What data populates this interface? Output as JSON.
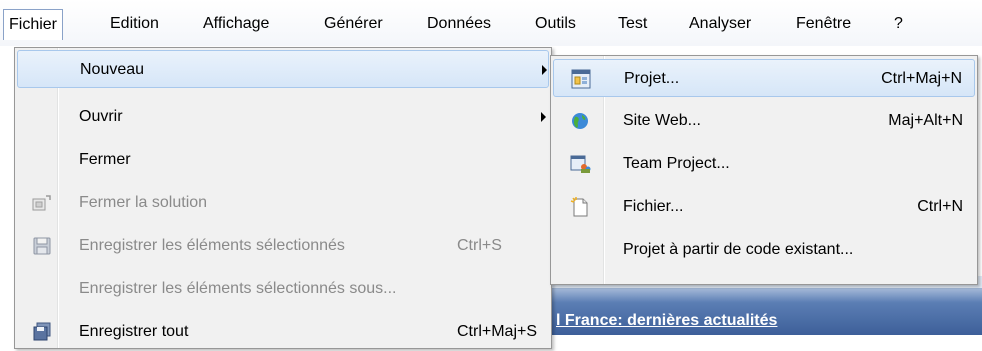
{
  "menubar": {
    "items": [
      {
        "label": "Fichier",
        "open": true
      },
      {
        "label": "Edition"
      },
      {
        "label": "Affichage"
      },
      {
        "label": "Générer"
      },
      {
        "label": "Données"
      },
      {
        "label": "Outils"
      },
      {
        "label": "Test"
      },
      {
        "label": "Analyser"
      },
      {
        "label": "Fenêtre"
      },
      {
        "label": "?"
      }
    ]
  },
  "file_menu": {
    "items": [
      {
        "label": "Nouveau",
        "submenu": true,
        "highlighted": true
      },
      {
        "label": "Ouvrir",
        "submenu": true
      },
      {
        "label": "Fermer"
      },
      {
        "label": "Fermer la solution",
        "disabled": true,
        "icon": "close-solution-icon"
      },
      {
        "label": "Enregistrer les éléments sélectionnés",
        "shortcut": "Ctrl+S",
        "disabled": true,
        "icon": "save-icon"
      },
      {
        "label": "Enregistrer les éléments sélectionnés sous...",
        "disabled": true
      },
      {
        "label": "Enregistrer tout",
        "shortcut": "Ctrl+Maj+S",
        "icon": "save-all-icon"
      }
    ]
  },
  "new_submenu": {
    "items": [
      {
        "label": "Projet...",
        "shortcut": "Ctrl+Maj+N",
        "highlighted": true,
        "icon": "project-icon"
      },
      {
        "label": "Site Web...",
        "shortcut": "Maj+Alt+N",
        "icon": "website-globe-icon"
      },
      {
        "label": "Team Project...",
        "icon": "team-project-icon"
      },
      {
        "label": "Fichier...",
        "shortcut": "Ctrl+N",
        "icon": "new-file-icon"
      },
      {
        "label": "Projet à partir de code existant..."
      }
    ]
  },
  "background": {
    "caption": "l France: dernières actualités"
  },
  "colors": {
    "highlight_border": "#a8c8ec",
    "highlight_fill": "#d6e6f8",
    "disabled_text": "#8a8a8a",
    "window_blue": "#3d5f99"
  }
}
